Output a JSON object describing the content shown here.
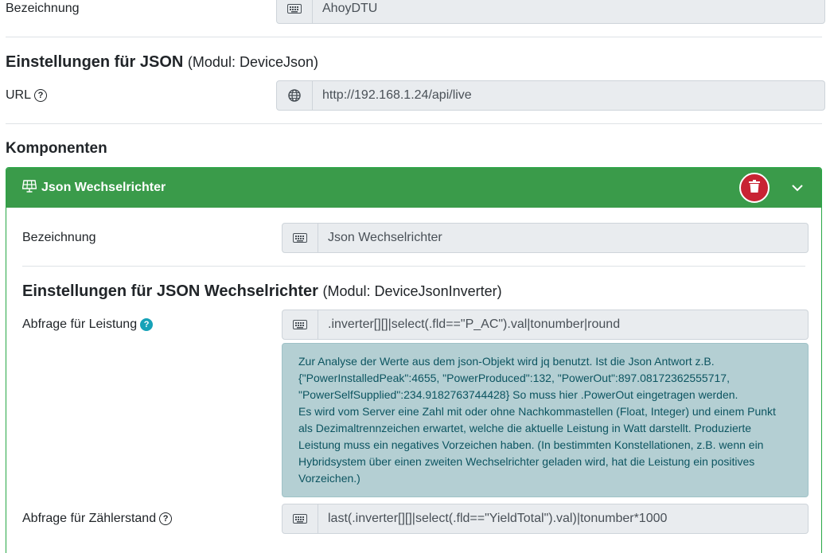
{
  "top": {
    "bezeichnung_label": "Bezeichnung",
    "bezeichnung_value": "AhoyDTU"
  },
  "json_section": {
    "title": "Einstellungen für JSON",
    "module": "(Modul: DeviceJson)",
    "url_label": "URL",
    "url_value": "http://192.168.1.24/api/live"
  },
  "components": {
    "title": "Komponenten",
    "card": {
      "title": "Json Wechselrichter",
      "bezeichnung_label": "Bezeichnung",
      "bezeichnung_value": "Json Wechselrichter",
      "settings_title": "Einstellungen für JSON Wechselrichter",
      "settings_module": "(Modul: DeviceJsonInverter)",
      "power_label": "Abfrage für Leistung",
      "power_value": ".inverter[][]|select(.fld==\"P_AC\").val|tonumber|round",
      "info_lines": [
        "Zur Analyse der Werte aus dem json-Objekt wird jq benutzt. Ist die Json Antwort z.B.",
        "{\"PowerInstalledPeak\":4655, \"PowerProduced\":132, \"PowerOut\":897.08172362555717,",
        "\"PowerSelfSupplied\":234.9182763744428} So muss hier .PowerOut eingetragen werden.",
        "Es wird vom Server eine Zahl mit oder ohne Nachkommastellen (Float, Integer) und einem Punkt",
        "als Dezimaltrennzeichen erwartet, welche die aktuelle Leistung in Watt darstellt. Produzierte",
        "Leistung muss ein negatives Vorzeichen haben. (In bestimmten Konstellationen, z.B. wenn ein",
        "Hybridsystem über einen zweiten Wechselrichter geladen wird, hat die Leistung ein positives",
        "Vorzeichen.)"
      ],
      "meter_label": "Abfrage für Zählerstand",
      "meter_value": "last(.inverter[][]|select(.fld==\"YieldTotal\").val)|tonumber*1000"
    }
  },
  "icons": {
    "keyboard": "keyboard-icon",
    "globe": "globe-icon",
    "help": "question-circle-icon",
    "solar": "solar-panel-icon",
    "trash": "trash-icon",
    "chevron": "chevron-down-icon"
  },
  "colors": {
    "card_header": "#3a9b4a",
    "delete_button": "#c82333",
    "info_background": "#b4cfd3",
    "info_text": "#0c5460",
    "help_teal": "#17a2b8"
  }
}
